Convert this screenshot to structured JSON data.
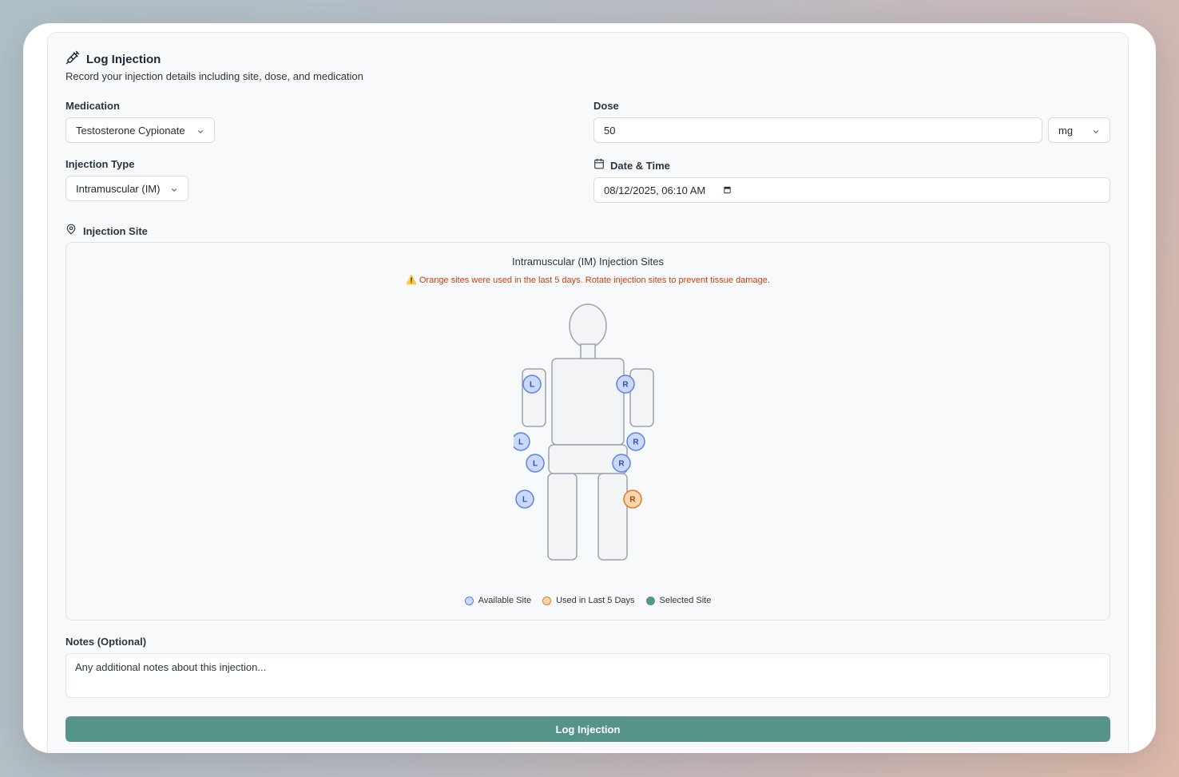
{
  "header": {
    "title": "Log Injection",
    "subtitle": "Record your injection details including site, dose, and medication"
  },
  "medication": {
    "label": "Medication",
    "value": "Testosterone Cypionate"
  },
  "dose": {
    "label": "Dose",
    "value": "50",
    "unit": "mg"
  },
  "injection_type": {
    "label": "Injection Type",
    "value": "Intramuscular (IM)"
  },
  "datetime": {
    "label": "Date & Time",
    "value": "08/12/2025, 06:10 AM"
  },
  "injection_site": {
    "label": "Injection Site",
    "panel_title": "Intramuscular (IM) Injection Sites",
    "warning_icon": "⚠️",
    "warning": "Orange sites were used in the last 5 days. Rotate injection sites to prevent tissue damage.",
    "sites": [
      {
        "id": "left-deltoid",
        "side": "L",
        "status": "available"
      },
      {
        "id": "right-deltoid",
        "side": "R",
        "status": "available"
      },
      {
        "id": "left-ventrogluteal",
        "side": "L",
        "status": "available"
      },
      {
        "id": "right-ventrogluteal",
        "side": "R",
        "status": "available"
      },
      {
        "id": "left-glute",
        "side": "L",
        "status": "available"
      },
      {
        "id": "right-glute",
        "side": "R",
        "status": "available"
      },
      {
        "id": "left-thigh",
        "side": "L",
        "status": "available"
      },
      {
        "id": "right-thigh",
        "side": "R",
        "status": "recent"
      }
    ],
    "legend": {
      "available": "Available Site",
      "recent": "Used in Last 5 Days",
      "selected": "Selected Site"
    }
  },
  "notes": {
    "label": "Notes (Optional)",
    "placeholder": "Any additional notes about this injection..."
  },
  "submit_label": "Log Injection",
  "colors": {
    "accent": "#56948a",
    "available_fill": "#c9d8fb",
    "available_stroke": "#5b82e6",
    "recent_fill": "#fbd5ad",
    "recent_stroke": "#e07b22",
    "warning": "#c2410c"
  },
  "icons": {
    "title": "syringe-icon",
    "datetime": "calendar-icon",
    "site": "map-pin-icon",
    "select": "chevron-down-icon"
  }
}
